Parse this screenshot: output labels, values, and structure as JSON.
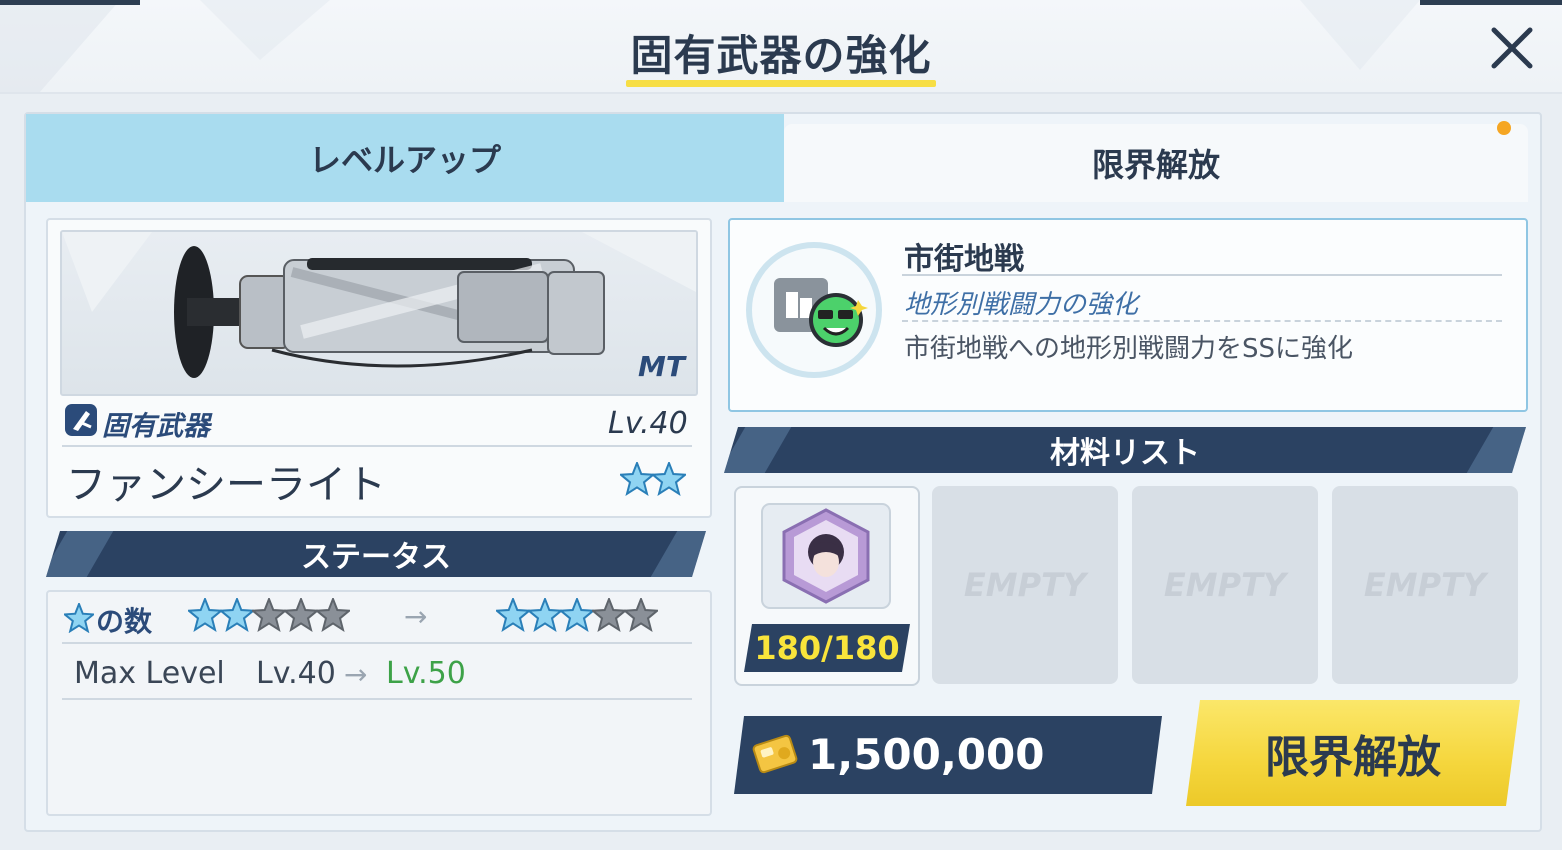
{
  "header": {
    "title": "固有武器の強化",
    "close_icon": "close-icon"
  },
  "tabs": {
    "level_up": "レベルアップ",
    "limit_break": "限界解放",
    "active": "limit_break"
  },
  "weapon": {
    "type_badge": "MT",
    "category": "固有武器",
    "level": "Lv.40",
    "name": "ファンシーライト",
    "stars": 2
  },
  "status": {
    "header": "ステータス",
    "star_row_label": "の数",
    "stars_from": 2,
    "stars_to": 3,
    "stars_max": 5,
    "max_level_label": "Max Level",
    "max_level_from": "Lv.40",
    "max_level_to": "Lv.50"
  },
  "skill": {
    "title": "市街地戦",
    "subtitle": "地形別戦闘力の強化",
    "description": "市街地戦への地形別戦闘力をSSに強化"
  },
  "materials": {
    "header": "材料リスト",
    "item_count": "180/180",
    "empty_label": "EMPTY"
  },
  "cost": {
    "credits": "1,500,000"
  },
  "actions": {
    "limit_break_button": "限界解放"
  },
  "colors": {
    "accent_yellow": "#f5d63c",
    "navy": "#2b4262",
    "tab_blue": "#a9dcef",
    "green": "#3da248"
  }
}
